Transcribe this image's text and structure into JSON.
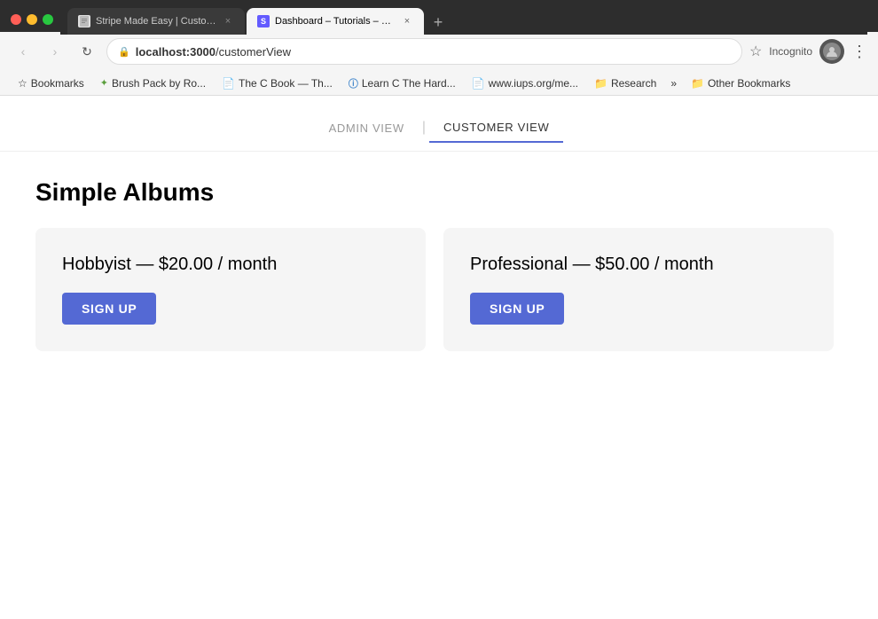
{
  "browser": {
    "traffic_lights": [
      "red",
      "yellow",
      "green"
    ],
    "tabs": [
      {
        "id": "tab-1",
        "favicon_type": "page",
        "label": "Stripe Made Easy | Customer V",
        "active": false,
        "close_label": "×"
      },
      {
        "id": "tab-2",
        "favicon_type": "stripe",
        "favicon_text": "S",
        "label": "Dashboard – Tutorials – Stripe",
        "active": true,
        "close_label": "×"
      }
    ],
    "new_tab_label": "+",
    "nav": {
      "back_label": "‹",
      "forward_label": "›",
      "reload_label": "↻"
    },
    "address_bar": {
      "lock_icon": "🔒",
      "url_plain": "localhost:3000/customerView",
      "url_domain": "localhost:3000",
      "url_path": "/customerView"
    },
    "bookmark_star": "☆",
    "incognito_label": "Incognito",
    "more_label": "⋮",
    "bookmarks": {
      "label": "Bookmarks",
      "items": [
        {
          "icon": "⭐",
          "label": "Brush Pack by Ro..."
        },
        {
          "icon": "📄",
          "label": "The C Book — Th..."
        },
        {
          "icon": "ⓘ",
          "label": "Learn C The Hard..."
        },
        {
          "icon": "📄",
          "label": "www.iups.org/me..."
        },
        {
          "icon": "📁",
          "label": "Research"
        }
      ],
      "more_label": "»",
      "other_folder_icon": "📁",
      "other_folder_label": "Other Bookmarks"
    }
  },
  "page": {
    "view_tabs": [
      {
        "id": "admin",
        "label": "ADMIN VIEW",
        "active": false
      },
      {
        "id": "customer",
        "label": "CUSTOMER VIEW",
        "active": true
      }
    ],
    "divider": "|",
    "title": "Simple Albums",
    "plans": [
      {
        "id": "hobbyist",
        "title": "Hobbyist — $20.00 / month",
        "signup_label": "SIGN UP"
      },
      {
        "id": "professional",
        "title": "Professional — $50.00 / month",
        "signup_label": "SIGN UP"
      }
    ]
  },
  "colors": {
    "accent": "#5469d4",
    "bg_card": "#f5f5f5"
  }
}
